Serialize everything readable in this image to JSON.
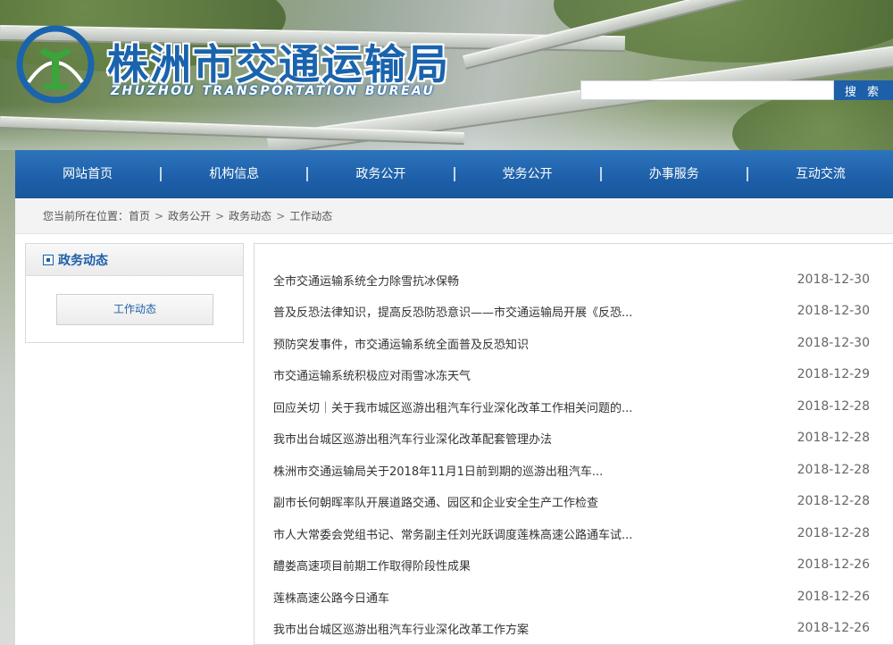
{
  "header": {
    "site_title": "株洲市交通运输局",
    "site_subtitle": "ZHUZHOU TRANSPORTATION BUREAU",
    "search_placeholder": "",
    "search_button": "搜 索",
    "brand_color": "#1d5fa8"
  },
  "nav": {
    "items": [
      {
        "label": "网站首页"
      },
      {
        "label": "机构信息"
      },
      {
        "label": "政务公开"
      },
      {
        "label": "党务公开"
      },
      {
        "label": "办事服务"
      },
      {
        "label": "互动交流"
      }
    ]
  },
  "breadcrumb": {
    "prefix": "您当前所在位置：",
    "items": [
      "首页",
      "政务公开",
      "政务动态",
      "工作动态"
    ],
    "separator": ">"
  },
  "sidebar": {
    "title": "政务动态",
    "items": [
      {
        "label": "工作动态"
      }
    ]
  },
  "news": {
    "items": [
      {
        "title": "全市交通运输系统全力除雪抗冰保畅",
        "date": "2018-12-30"
      },
      {
        "title": "普及反恐法律知识，提高反恐防恐意识——市交通运输局开展《反恐...",
        "date": "2018-12-30"
      },
      {
        "title": "预防突发事件，市交通运输系统全面普及反恐知识",
        "date": "2018-12-30"
      },
      {
        "title": "市交通运输系统积极应对雨雪冰冻天气",
        "date": "2018-12-29"
      },
      {
        "title": "回应关切｜关于我市城区巡游出租汽车行业深化改革工作相关问题的...",
        "date": "2018-12-28"
      },
      {
        "title": "我市出台城区巡游出租汽车行业深化改革配套管理办法",
        "date": "2018-12-28"
      },
      {
        "title": "株洲市交通运输局关于2018年11月1日前到期的巡游出租汽车...",
        "date": "2018-12-28"
      },
      {
        "title": "副市长何朝晖率队开展道路交通、园区和企业安全生产工作检查",
        "date": "2018-12-28"
      },
      {
        "title": "市人大常委会党组书记、常务副主任刘光跃调度莲株高速公路通车试...",
        "date": "2018-12-28"
      },
      {
        "title": "醴娄高速项目前期工作取得阶段性成果",
        "date": "2018-12-26"
      },
      {
        "title": "莲株高速公路今日通车",
        "date": "2018-12-26"
      },
      {
        "title": "我市出台城区巡游出租汽车行业深化改革工作方案",
        "date": "2018-12-26"
      }
    ]
  }
}
